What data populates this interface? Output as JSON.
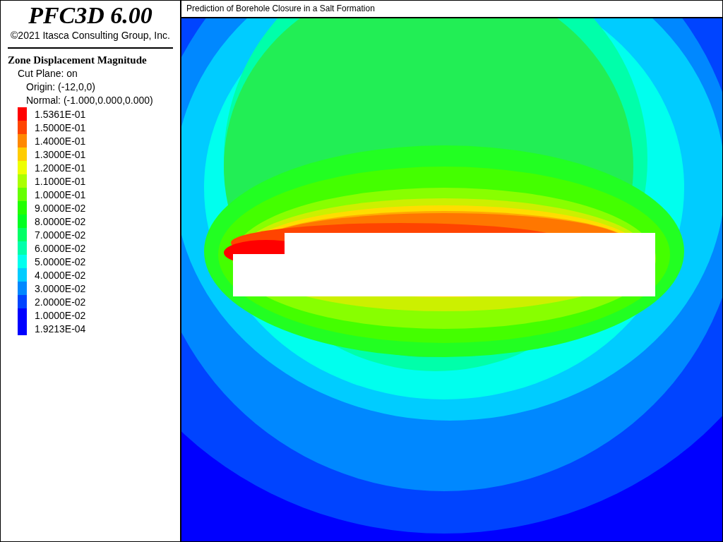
{
  "sidebar": {
    "title": "PFC3D 6.00",
    "copyright": "©2021 Itasca Consulting Group, Inc.",
    "legend": {
      "title": "Zone Displacement Magnitude",
      "cut_plane": "Cut Plane: on",
      "origin": "Origin: (-12,0,0)",
      "normal": "Normal: (-1.000,0.000,0.000)",
      "items": [
        {
          "label": "1.5361E-01",
          "color": "#ff0000"
        },
        {
          "label": "1.5000E-01",
          "color": "#ff4400"
        },
        {
          "label": "1.4000E-01",
          "color": "#ff8800"
        },
        {
          "label": "1.3000E-01",
          "color": "#ffcc00"
        },
        {
          "label": "1.2000E-01",
          "color": "#eeff00"
        },
        {
          "label": "1.1000E-01",
          "color": "#aaff00"
        },
        {
          "label": "1.0000E-01",
          "color": "#66ff00"
        },
        {
          "label": "9.0000E-02",
          "color": "#22ff00"
        },
        {
          "label": "8.0000E-02",
          "color": "#00ff22"
        },
        {
          "label": "7.0000E-02",
          "color": "#00ff66"
        },
        {
          "label": "6.0000E-02",
          "color": "#00ffaa"
        },
        {
          "label": "5.0000E-02",
          "color": "#00ffee"
        },
        {
          "label": "4.0000E-02",
          "color": "#00ccff"
        },
        {
          "label": "3.0000E-02",
          "color": "#0088ff"
        },
        {
          "label": "2.0000E-02",
          "color": "#0044ff"
        },
        {
          "label": "1.0000E-02",
          "color": "#0000ff"
        },
        {
          "label": "1.9213E-04",
          "color": "#0000ff"
        }
      ]
    }
  },
  "plot": {
    "title": "Prediction of Borehole Closure in a Salt Formation"
  }
}
